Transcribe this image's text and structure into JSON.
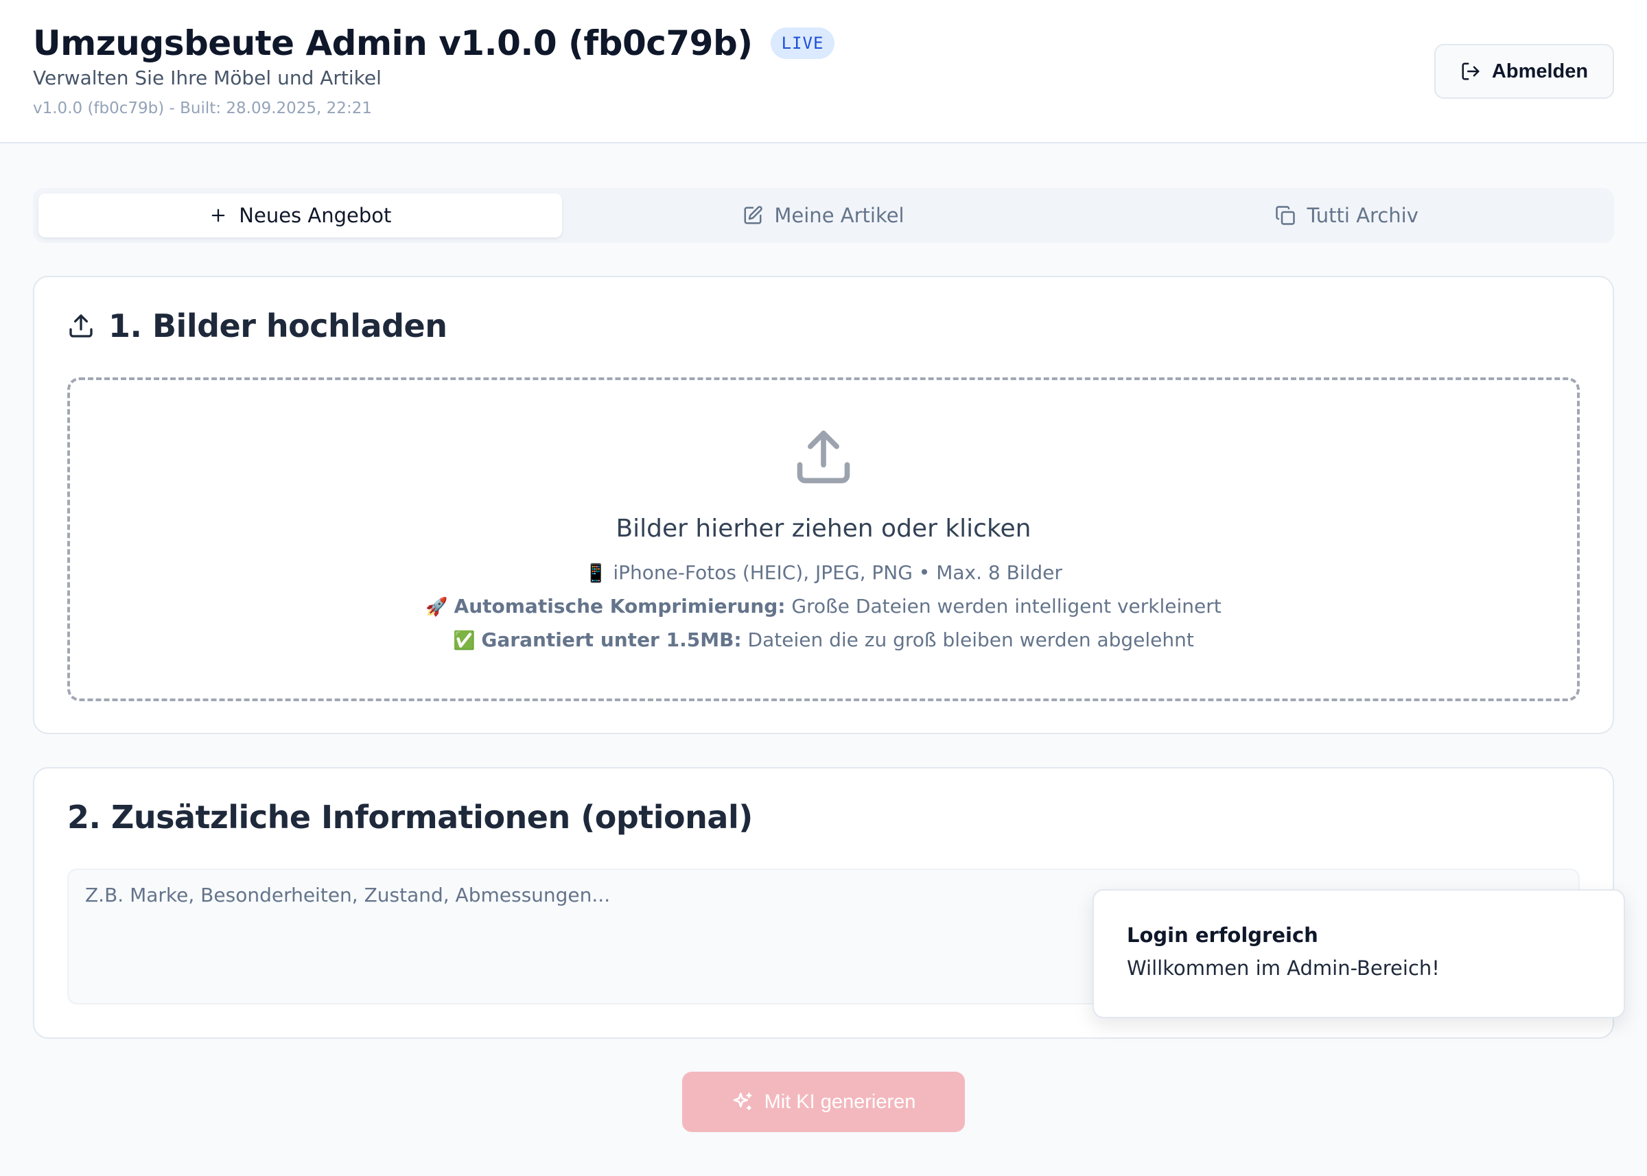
{
  "header": {
    "title": "Umzugsbeute Admin v1.0.0 (fb0c79b)",
    "badge": "LIVE",
    "subtitle": "Verwalten Sie Ihre Möbel und Artikel",
    "build_info": "v1.0.0 (fb0c79b) - Built: 28.09.2025, 22:21",
    "logout_label": "Abmelden",
    "logout_icon": "logout-icon"
  },
  "tabs": [
    {
      "label": "Neues Angebot",
      "icon": "plus-icon",
      "active": true
    },
    {
      "label": "Meine Artikel",
      "icon": "edit-icon",
      "active": false
    },
    {
      "label": "Tutti Archiv",
      "icon": "copy-icon",
      "active": false
    }
  ],
  "upload": {
    "title": "1. Bilder hochladen",
    "icon": "upload-icon",
    "dropzone_title": "Bilder hierher ziehen oder klicken",
    "line1": {
      "emoji": "📱",
      "text": "iPhone-Fotos (HEIC), JPEG, PNG • Max. 8 Bilder"
    },
    "line2": {
      "emoji": "🚀",
      "bold": "Automatische Komprimierung:",
      "text": "Große Dateien werden intelligent verkleinert"
    },
    "line3": {
      "emoji": "✅",
      "bold": "Garantiert unter 1.5MB:",
      "text": "Dateien die zu groß bleiben werden abgelehnt"
    }
  },
  "info": {
    "title": "2. Zusätzliche Informationen (optional)",
    "placeholder": "Z.B. Marke, Besonderheiten, Zustand, Abmessungen...",
    "value": ""
  },
  "generate": {
    "label": "Mit KI generieren",
    "icon": "sparkles-icon",
    "color": "#f3b8be"
  },
  "toast": {
    "title": "Login erfolgreich",
    "message": "Willkommen im Admin-Bereich!"
  },
  "colors": {
    "background": "#f8fafc",
    "badge_bg": "#dbeafe",
    "badge_text": "#1d4ed8",
    "primary_disabled": "#f3b8be"
  }
}
